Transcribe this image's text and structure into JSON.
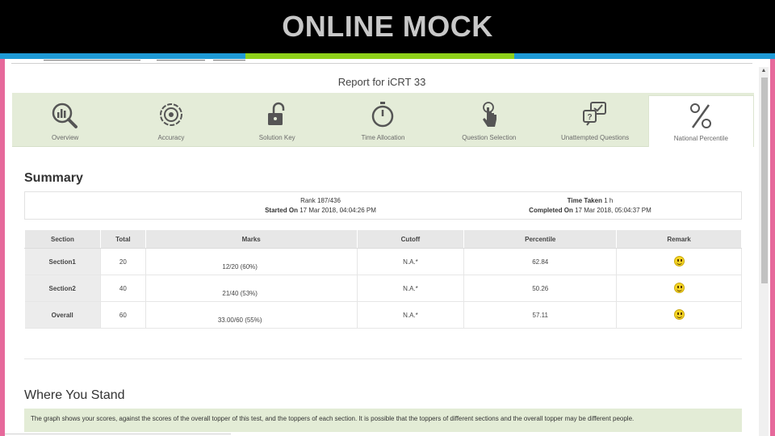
{
  "slide": {
    "title": "ONLINE MOCK",
    "colors": {
      "title_bg": "#000000",
      "stripe_blue": "#1e9ad6",
      "stripe_green": "#8fd11a",
      "edge_pink": "#e6699b",
      "tab_bg": "#e4ecd8"
    }
  },
  "report": {
    "title": "Report for iCRT 33",
    "tabs": [
      {
        "label": "Overview",
        "icon": "magnifier-chart-icon"
      },
      {
        "label": "Accuracy",
        "icon": "target-icon"
      },
      {
        "label": "Solution Key",
        "icon": "unlock-icon"
      },
      {
        "label": "Time Allocation",
        "icon": "stopwatch-icon"
      },
      {
        "label": "Question Selection",
        "icon": "tap-finger-icon"
      },
      {
        "label": "Unattempted Questions",
        "icon": "question-chat-icon"
      },
      {
        "label": "National Percentile",
        "icon": "percent-icon",
        "active": true
      }
    ]
  },
  "summary": {
    "heading": "Summary",
    "rank_label": "Rank",
    "rank_value": "187/436",
    "started_label": "Started On",
    "started_value": "17 Mar 2018, 04:04:26 PM",
    "time_label": "Time Taken",
    "time_value": "1 h",
    "completed_label": "Completed On",
    "completed_value": "17 Mar 2018, 05:04:37 PM"
  },
  "table": {
    "headers": [
      "Section",
      "Total",
      "Marks",
      "Cutoff",
      "Percentile",
      "Remark"
    ],
    "rows": [
      {
        "section": "Section1",
        "total": "20",
        "marks": "12/20 (60%)",
        "cutoff": "N.A.*",
        "percentile": "62.84",
        "remark": "smiley-icon"
      },
      {
        "section": "Section2",
        "total": "40",
        "marks": "21/40 (53%)",
        "cutoff": "N.A.*",
        "percentile": "50.26",
        "remark": "smiley-icon"
      },
      {
        "section": "Overall",
        "total": "60",
        "marks": "33.00/60 (55%)",
        "cutoff": "N.A.*",
        "percentile": "57.11",
        "remark": "smiley-icon"
      }
    ]
  },
  "stand": {
    "heading": "Where You Stand",
    "note": "The graph shows your scores, against the scores of the overall topper of this test, and the toppers of each section. It is possible that the toppers of different sections and the overall topper may be different people."
  }
}
